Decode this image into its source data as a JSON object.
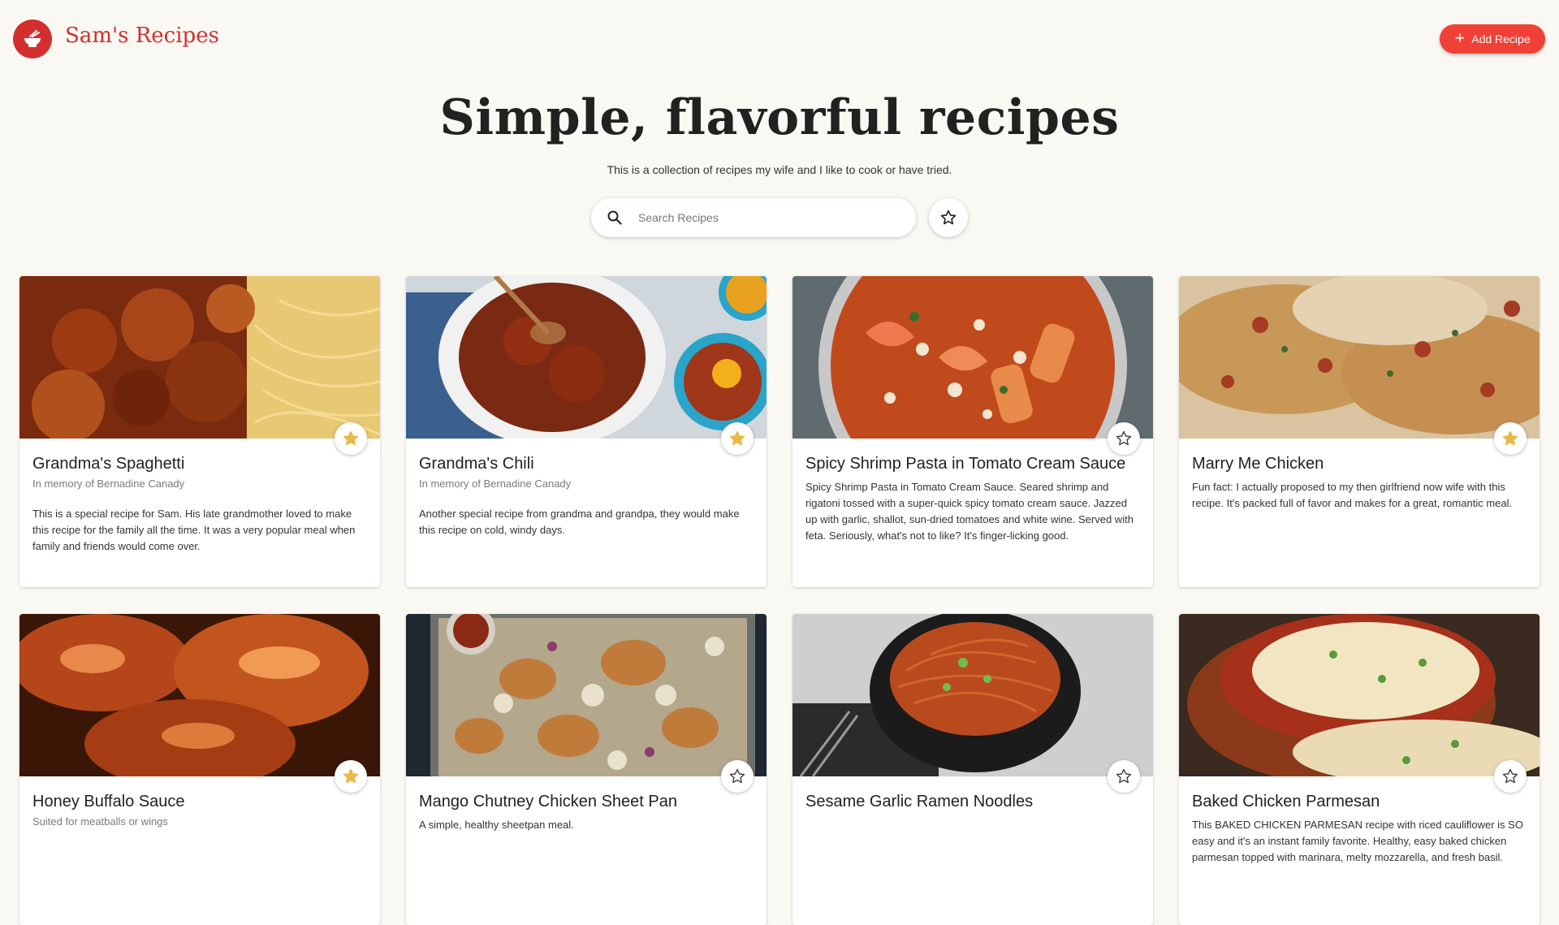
{
  "header": {
    "brand": "Sam's Recipes",
    "logo_icon": "bowl-icon",
    "add_button_label": "Add Recipe",
    "accent_color": "#d32f2f"
  },
  "hero": {
    "title": "Simple, flavorful recipes",
    "subtitle": "This is a collection of recipes my wife and I like to cook or have tried."
  },
  "search": {
    "placeholder": "Search Recipes",
    "value": ""
  },
  "recipes": [
    {
      "title": "Grandma's Spaghetti",
      "subtitle": "In memory of Bernadine Canady",
      "description": "This is a special recipe for Sam. His late grandmother loved to make this recipe for the family all the time. It was a very popular meal when family and friends would come over.",
      "favorite": true
    },
    {
      "title": "Grandma's Chili",
      "subtitle": "In memory of Bernadine Canady",
      "description": "Another special recipe from grandma and grandpa, they would make this recipe on cold, windy days.",
      "favorite": true
    },
    {
      "title": "Spicy Shrimp Pasta in Tomato Cream Sauce",
      "subtitle": "",
      "description": "Spicy Shrimp Pasta in Tomato Cream Sauce. Seared shrimp and rigatoni tossed with a super-quick spicy tomato cream sauce. Jazzed up with garlic, shallot, sun-dried tomatoes and white wine. Served with feta. Seriously, what's not to like? It's finger-licking good.",
      "favorite": false
    },
    {
      "title": "Marry Me Chicken",
      "subtitle": "",
      "description": "Fun fact: I actually proposed to my then girlfriend now wife with this recipe. It's packed full of favor and makes for a great, romantic meal.",
      "favorite": true
    },
    {
      "title": "Honey Buffalo Sauce",
      "subtitle": "Suited for meatballs or wings",
      "description": "",
      "favorite": true
    },
    {
      "title": "Mango Chutney Chicken Sheet Pan",
      "subtitle": "",
      "description": "A simple, healthy sheetpan meal.",
      "favorite": false
    },
    {
      "title": "Sesame Garlic Ramen Noodles",
      "subtitle": "",
      "description": "",
      "favorite": false
    },
    {
      "title": "Baked Chicken Parmesan",
      "subtitle": "",
      "description": "This BAKED CHICKEN PARMESAN recipe with riced cauliflower is SO easy and it's an instant family favorite. Healthy, easy baked chicken parmesan topped with marinara, melty mozzarella, and fresh basil.",
      "favorite": false
    }
  ],
  "colors": {
    "background": "#f9f8f3",
    "accent": "#d32f2f",
    "button": "#ef4135",
    "favorite_star": "#e8b84a"
  }
}
